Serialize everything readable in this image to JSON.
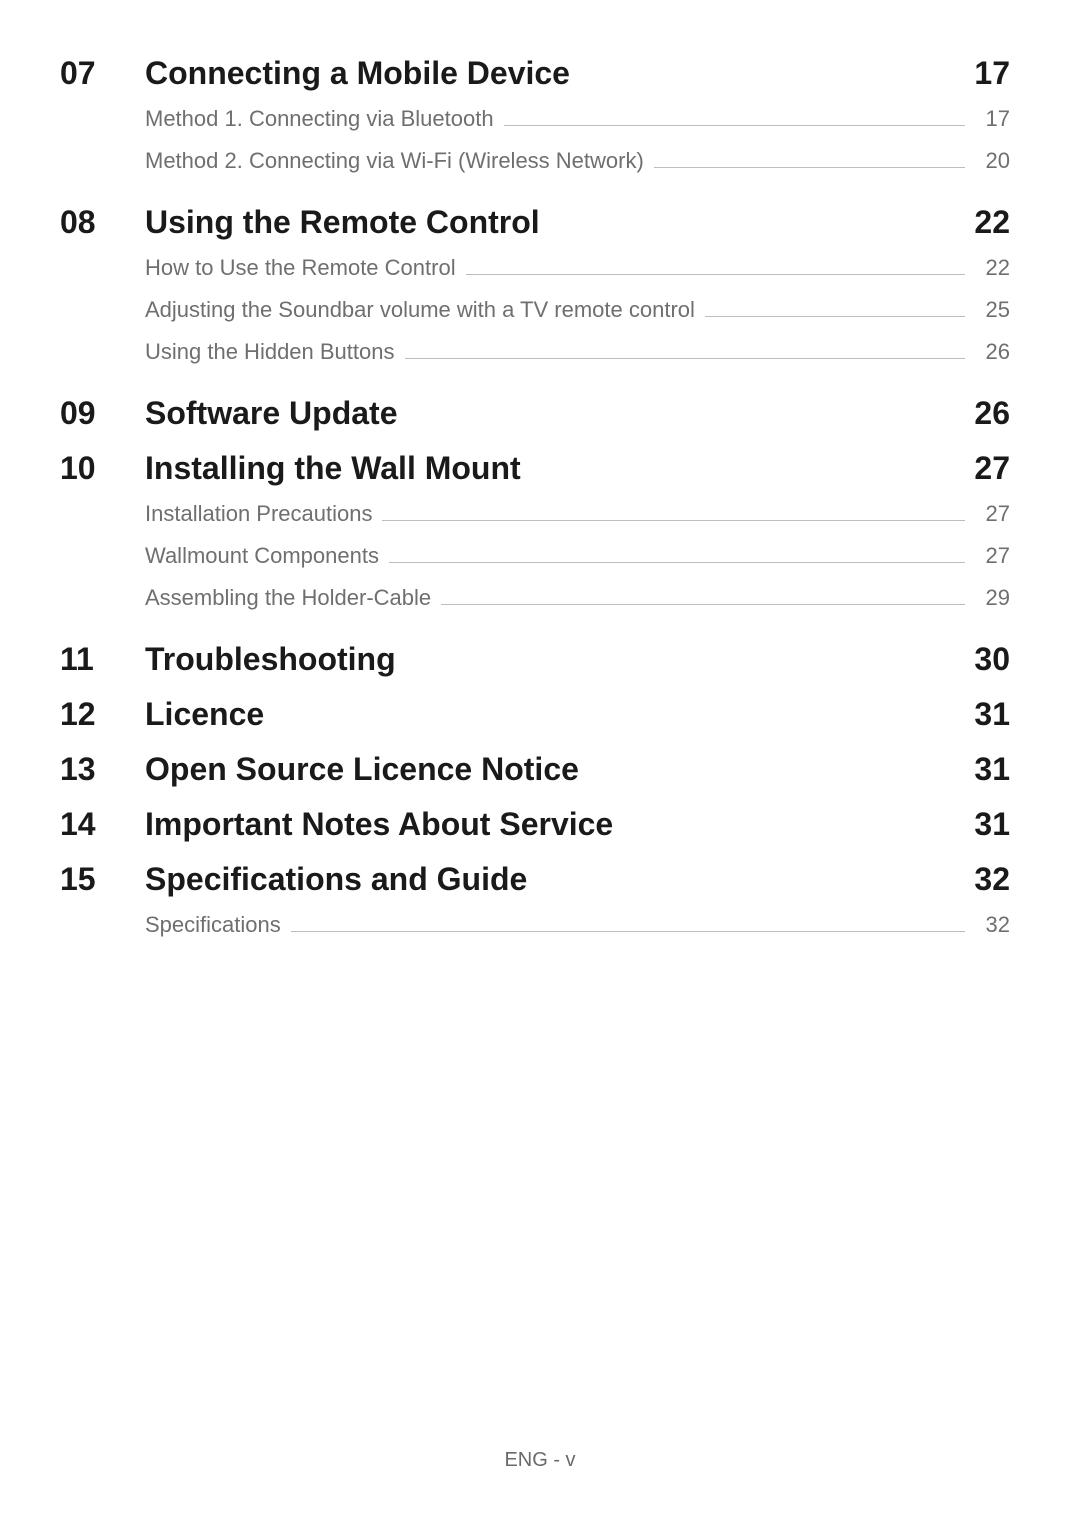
{
  "toc": [
    {
      "num": "07",
      "title": "Connecting a Mobile Device",
      "page": "17",
      "subitems": [
        {
          "title": "Method 1. Connecting via Bluetooth",
          "page": "17"
        },
        {
          "title": "Method 2. Connecting via Wi-Fi (Wireless Network)",
          "page": "20"
        }
      ]
    },
    {
      "num": "08",
      "title": "Using the Remote Control",
      "page": "22",
      "subitems": [
        {
          "title": "How to Use the Remote Control",
          "page": "22"
        },
        {
          "title": "Adjusting the Soundbar volume with a TV remote control",
          "page": "25"
        },
        {
          "title": "Using the Hidden Buttons",
          "page": "26"
        }
      ]
    },
    {
      "num": "09",
      "title": "Software Update",
      "page": "26",
      "subitems": []
    },
    {
      "num": "10",
      "title": "Installing the Wall Mount",
      "page": "27",
      "subitems": [
        {
          "title": "Installation Precautions",
          "page": "27"
        },
        {
          "title": "Wallmount Components",
          "page": "27"
        },
        {
          "title": "Assembling the Holder-Cable",
          "page": "29"
        }
      ]
    },
    {
      "num": "11",
      "title": "Troubleshooting",
      "page": "30",
      "subitems": []
    },
    {
      "num": "12",
      "title": "Licence",
      "page": "31",
      "subitems": []
    },
    {
      "num": "13",
      "title": "Open Source Licence Notice",
      "page": "31",
      "subitems": []
    },
    {
      "num": "14",
      "title": "Important Notes About Service",
      "page": "31",
      "subitems": []
    },
    {
      "num": "15",
      "title": "Specifications and Guide",
      "page": "32",
      "subitems": [
        {
          "title": "Specifications",
          "page": "32"
        }
      ]
    }
  ],
  "footer": "ENG - v"
}
